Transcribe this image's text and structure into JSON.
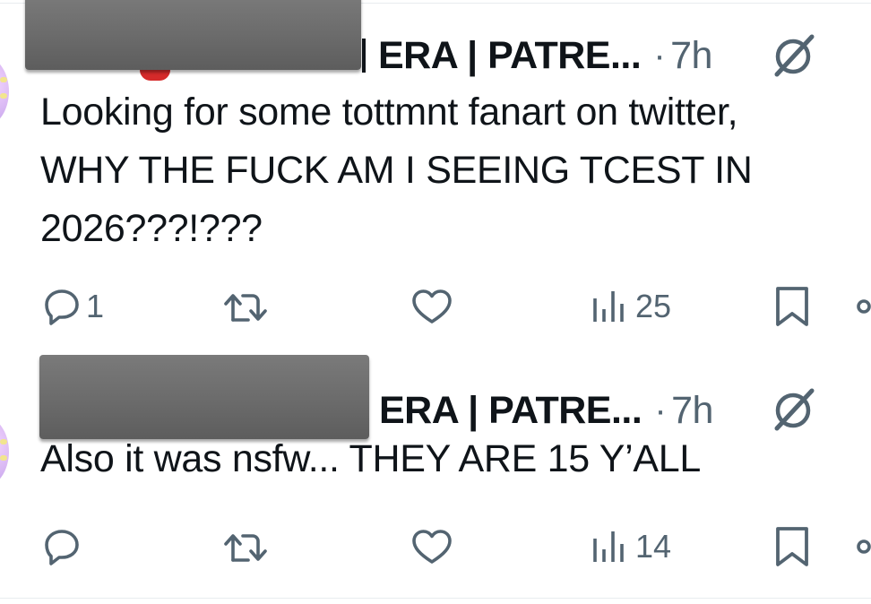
{
  "tweets": [
    {
      "author": {
        "display_name_visible": "ERA | PATRE...",
        "avatar_name": "avatar"
      },
      "separator": "·",
      "time": "7h",
      "body_lines": [
        "Looking for some tottmnt fanart on twitter,",
        "WHY THE FUCK AM I SEEING TCEST IN",
        "2026???!???"
      ],
      "actions": {
        "reply_count": "1",
        "retweet_count": "",
        "like_count": "",
        "views_count": "25"
      }
    },
    {
      "author": {
        "display_name_visible": "ERA | PATRE...",
        "avatar_name": "avatar"
      },
      "separator": "·",
      "time": "7h",
      "body_lines": [
        "Also it was nsfw... THEY ARE 15 Y’ALL"
      ],
      "actions": {
        "reply_count": "",
        "retweet_count": "",
        "like_count": "",
        "views_count": "14"
      }
    }
  ],
  "icons": {
    "reply": "reply-icon",
    "retweet": "retweet-icon",
    "like": "heart-icon",
    "views": "views-icon",
    "bookmark": "bookmark-icon",
    "share": "share-icon",
    "grok": "grok-icon"
  },
  "colors": {
    "text": "#0f1419",
    "secondary": "#536471",
    "divider": "#e8ecef",
    "redaction": "#6b6b6b"
  }
}
